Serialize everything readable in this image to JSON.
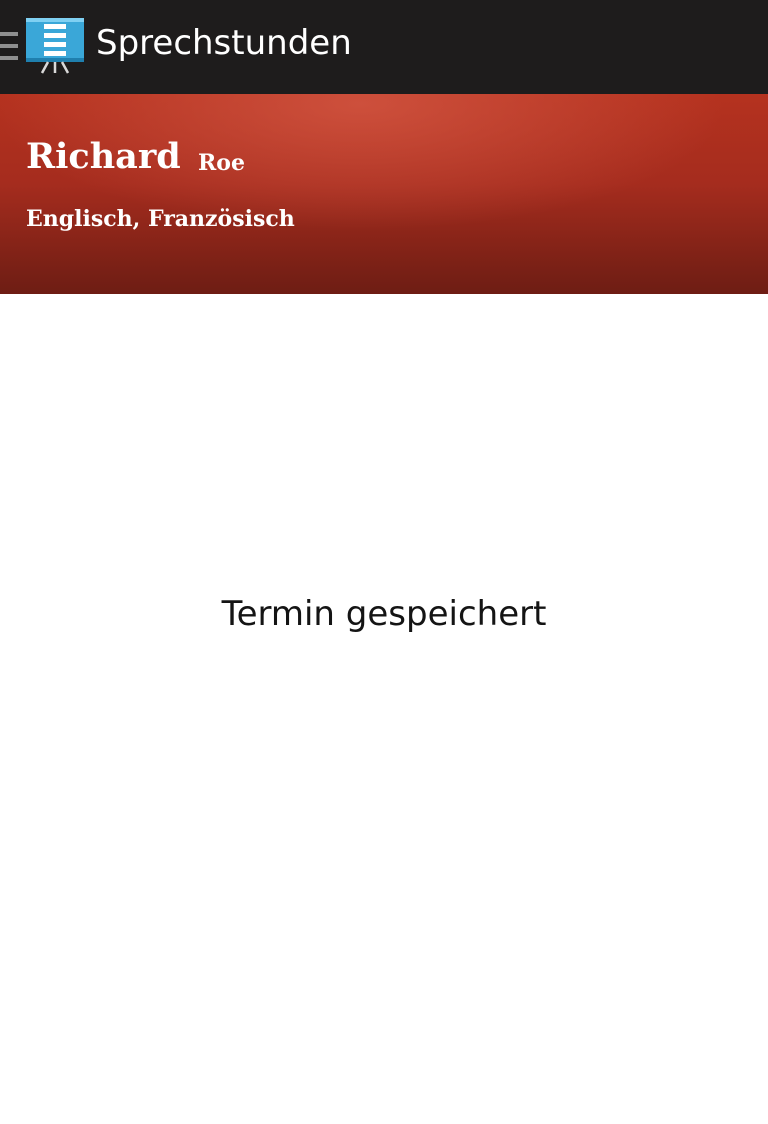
{
  "action_bar": {
    "title": "Sprechstunden",
    "drawer_icon": "menu-icon",
    "app_icon": "presentation-board-icon",
    "background_color": "#1e1c1c"
  },
  "teacher": {
    "first_name": "Richard",
    "last_name": "Roe",
    "subjects": "Englisch, Französisch"
  },
  "header": {
    "background_color": "#a52c1e"
  },
  "main": {
    "message": "Termin gespeichert"
  }
}
